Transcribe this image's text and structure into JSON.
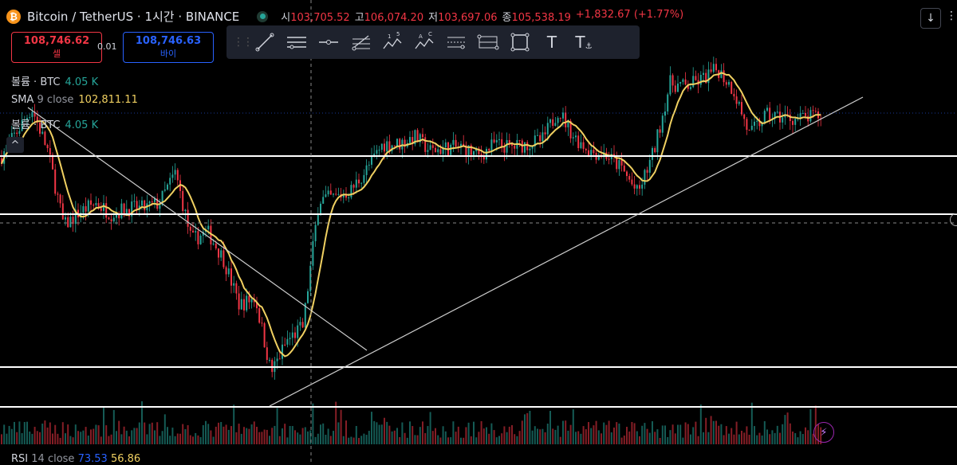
{
  "header": {
    "title": "Bitcoin / TetherUS · 1시간 · BINANCE",
    "ohlc": [
      {
        "label": "시",
        "value": "103,705.52"
      },
      {
        "label": "고",
        "value": "106,074.20"
      },
      {
        "label": "저",
        "value": "103,697.06"
      },
      {
        "label": "종",
        "value": "105,538.19"
      }
    ],
    "change": "+1,832.67 (+1.77%)"
  },
  "trade": {
    "sell_price": "108,746.62",
    "sell_label": "셀",
    "spread": "0.01",
    "buy_price": "108,746.63",
    "buy_label": "바이"
  },
  "toolbar": {
    "tools": [
      "trend-line-tool",
      "horizontal-lines-tool",
      "horizontal-ray-tool",
      "fib-retracement-tool",
      "elliott-wave-tool",
      "abcd-pattern-tool",
      "price-range-tool",
      "date-range-tool",
      "rectangle-tool",
      "text-tool",
      "anchored-text-tool"
    ],
    "elliott_labels": [
      "1",
      "5"
    ],
    "abcd_labels": [
      "A",
      "C"
    ],
    "text_glyph": "T"
  },
  "legends": {
    "volume1_name": "볼륨 · BTC",
    "volume1_value": "4.05 K",
    "sma_name": "SMA",
    "sma_params": "9 close",
    "sma_value": "102,811.11",
    "volume2_name": "볼륨 · BTC",
    "volume2_value": "4.05 K"
  },
  "rsi": {
    "name": "RSI",
    "params": "14 close",
    "value1": "73.53",
    "value2": "56.86"
  },
  "colors": {
    "up": "#26a69a",
    "down": "#f23645",
    "sma": "#f0d061",
    "background": "#000000",
    "buy": "#2962ff"
  },
  "chart_data": {
    "type": "candlestick",
    "price_path": [
      [
        0,
        103800
      ],
      [
        20,
        105200
      ],
      [
        40,
        106600
      ],
      [
        60,
        104200
      ],
      [
        80,
        100000
      ],
      [
        100,
        100800
      ],
      [
        120,
        101300
      ],
      [
        140,
        100700
      ],
      [
        160,
        101000
      ],
      [
        180,
        101000
      ],
      [
        200,
        101300
      ],
      [
        220,
        103000
      ],
      [
        240,
        99200
      ],
      [
        260,
        99700
      ],
      [
        280,
        98200
      ],
      [
        300,
        95600
      ],
      [
        320,
        96000
      ],
      [
        340,
        91800
      ],
      [
        360,
        93600
      ],
      [
        380,
        94400
      ],
      [
        400,
        101500
      ],
      [
        420,
        101600
      ],
      [
        440,
        102000
      ],
      [
        460,
        103200
      ],
      [
        480,
        104600
      ],
      [
        500,
        104600
      ],
      [
        520,
        105000
      ],
      [
        540,
        104200
      ],
      [
        560,
        104400
      ],
      [
        580,
        104400
      ],
      [
        600,
        103900
      ],
      [
        620,
        104600
      ],
      [
        640,
        104400
      ],
      [
        660,
        104600
      ],
      [
        680,
        104800
      ],
      [
        700,
        106500
      ],
      [
        720,
        105000
      ],
      [
        740,
        104200
      ],
      [
        760,
        104000
      ],
      [
        780,
        103200
      ],
      [
        800,
        101800
      ],
      [
        820,
        104200
      ],
      [
        840,
        108000
      ],
      [
        860,
        107800
      ],
      [
        880,
        108200
      ],
      [
        900,
        108800
      ],
      [
        920,
        107600
      ],
      [
        940,
        105100
      ],
      [
        960,
        106200
      ],
      [
        980,
        106100
      ],
      [
        1000,
        106000
      ],
      [
        1020,
        106100
      ],
      [
        1032,
        106200
      ]
    ],
    "sma_name": "SMA 9 close",
    "volume_name": "볼륨 · BTC"
  }
}
